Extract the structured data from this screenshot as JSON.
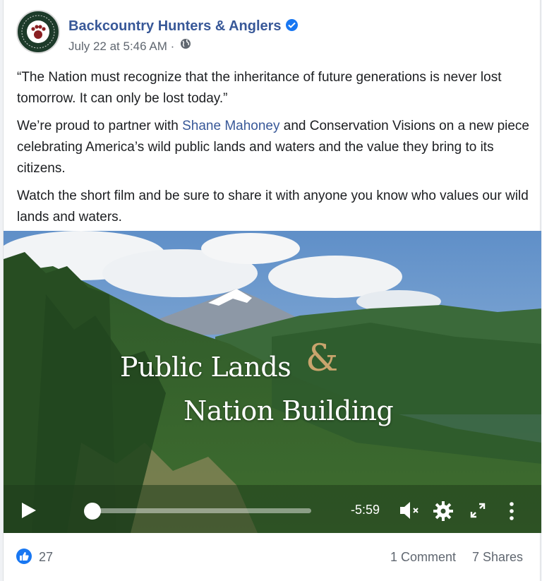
{
  "post": {
    "author": "Backcountry Hunters & Anglers",
    "date": "July 22 at 5:46 AM",
    "separator": "·",
    "paragraphs": {
      "p1": "“The Nation must recognize that the inheritance of future generations is never lost tomorrow. It can only be lost today.”",
      "p2_before": "We’re proud to partner with ",
      "p2_link": "Shane Mahoney",
      "p2_after": " and Conservation Visions on a new piece celebrating America’s wild public lands and waters and the value they bring to its citizens.",
      "p3": "Watch the short film and be sure to share it with anyone you know who values our wild lands and waters."
    }
  },
  "video": {
    "title_line1": "Public Lands",
    "title_amp": "&",
    "title_line2": "Nation Building",
    "time_remaining": "-5:59",
    "progress": 0.03
  },
  "footer": {
    "like_count": "27",
    "comments": "1 Comment",
    "shares": "7 Shares"
  },
  "colors": {
    "link": "#385898",
    "like_blue": "#1877f2",
    "amp_gold": "#c9a46d"
  },
  "icons": [
    "verified-badge-icon",
    "globe-icon",
    "play-icon",
    "mute-icon",
    "settings-gear-icon",
    "fullscreen-icon",
    "more-options-icon",
    "like-icon"
  ]
}
